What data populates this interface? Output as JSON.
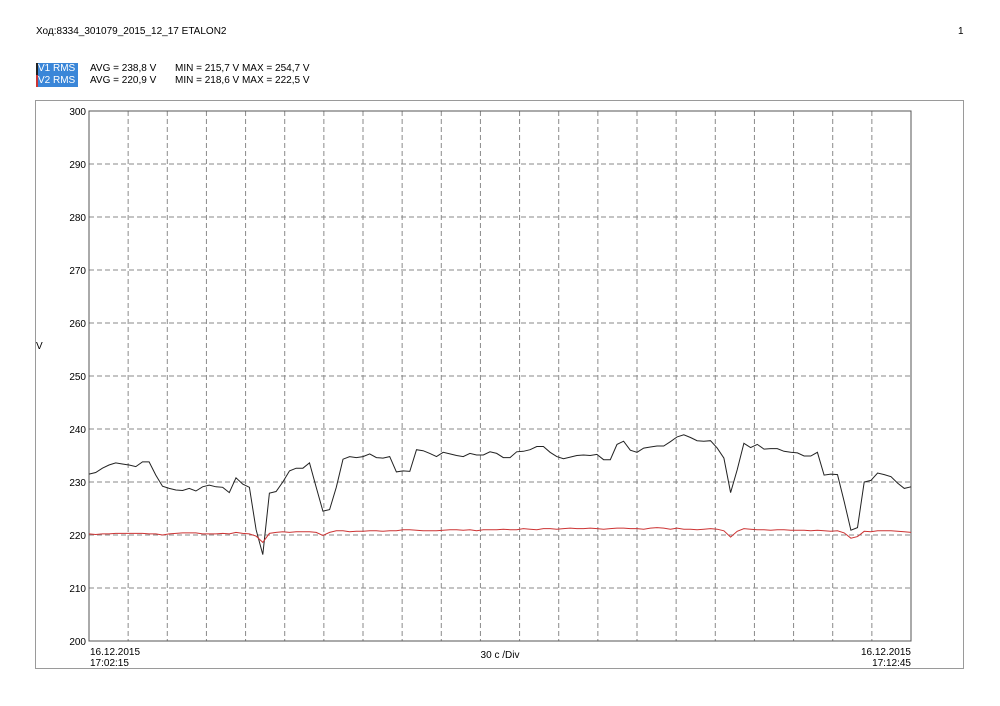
{
  "header": {
    "title": "Ход:8334_301079_2015_12_17 ETALON2",
    "page": "1"
  },
  "legend": [
    {
      "name": "V1 RMS",
      "avg": "AVG = 238,8 V",
      "minmax": "MIN = 215,7 V MAX = 254,7 V",
      "color": "#222222"
    },
    {
      "name": "V2 RMS",
      "avg": "AVG = 220,9 V",
      "minmax": "MIN = 218,6 V MAX = 222,5 V",
      "color": "#cc3333"
    }
  ],
  "axis": {
    "ylabel": "V",
    "xcenter": "30 c /Div",
    "start_date": "16.12.2015",
    "start_time": "17:02:15",
    "end_date": "16.12.2015",
    "end_time": "17:12:45"
  },
  "chart_data": {
    "type": "line",
    "ylabel": "V",
    "ylim": [
      200,
      300
    ],
    "yticks": [
      200,
      210,
      220,
      230,
      240,
      250,
      260,
      270,
      280,
      290,
      300
    ],
    "x_start": "16.12.2015 17:02:15",
    "x_end": "16.12.2015 17:12:45",
    "x_division": "30 c /Div",
    "grid": true,
    "series": [
      {
        "name": "V1 RMS",
        "color": "#222222",
        "values": [
          231.5,
          231.8,
          232.6,
          233.2,
          233.6,
          233.4,
          233.2,
          232.9,
          233.8,
          233.8,
          231.3,
          229.2,
          228.8,
          228.5,
          228.4,
          228.8,
          228.3,
          229.1,
          229.4,
          229.1,
          229.0,
          228.0,
          230.8,
          229.6,
          229.0,
          221.0,
          216.3,
          227.9,
          228.2,
          230.0,
          232.1,
          232.6,
          232.6,
          233.6,
          229.0,
          224.5,
          224.8,
          229.0,
          234.3,
          234.8,
          234.6,
          234.8,
          235.3,
          234.6,
          234.5,
          234.8,
          231.9,
          232.1,
          232.0,
          236.1,
          235.9,
          235.4,
          234.8,
          235.6,
          235.3,
          235.0,
          234.8,
          235.4,
          235.1,
          235.1,
          235.7,
          235.4,
          234.6,
          234.6,
          235.7,
          235.8,
          236.1,
          236.7,
          236.7,
          235.6,
          234.8,
          234.4,
          234.7,
          235.0,
          235.1,
          235.0,
          235.2,
          234.2,
          234.2,
          237.1,
          237.7,
          236.0,
          235.6,
          236.4,
          236.6,
          236.8,
          236.8,
          237.6,
          238.5,
          238.9,
          238.4,
          237.8,
          237.7,
          237.8,
          236.4,
          234.5,
          228.0,
          232.3,
          237.3,
          236.5,
          237.1,
          236.2,
          236.3,
          236.3,
          235.8,
          235.6,
          235.5,
          234.9,
          234.9,
          235.6,
          231.3,
          231.5,
          231.4,
          226.3,
          220.9,
          221.4,
          230.0,
          230.3,
          231.7,
          231.4,
          231.0,
          229.8,
          228.8,
          229.1
        ]
      },
      {
        "name": "V2 RMS",
        "color": "#cc3333",
        "values": [
          220.2,
          220.1,
          220.2,
          220.2,
          220.3,
          220.3,
          220.3,
          220.3,
          220.3,
          220.2,
          220.2,
          220.0,
          220.2,
          220.3,
          220.4,
          220.4,
          220.4,
          220.2,
          220.2,
          220.2,
          220.3,
          220.2,
          220.5,
          220.3,
          220.2,
          219.8,
          218.6,
          220.3,
          220.5,
          220.6,
          220.5,
          220.6,
          220.6,
          220.6,
          220.5,
          219.9,
          220.5,
          220.8,
          220.8,
          220.6,
          220.7,
          220.7,
          220.8,
          220.8,
          220.7,
          220.8,
          220.8,
          221.0,
          221.0,
          220.9,
          220.8,
          220.8,
          220.8,
          220.9,
          221.0,
          221.0,
          220.9,
          221.0,
          220.8,
          221.0,
          221.0,
          221.0,
          221.1,
          221.0,
          221.0,
          221.2,
          221.1,
          221.0,
          221.2,
          221.2,
          221.1,
          221.2,
          221.3,
          221.2,
          221.2,
          221.3,
          221.2,
          221.1,
          221.2,
          221.3,
          221.3,
          221.2,
          221.2,
          221.1,
          221.3,
          221.4,
          221.3,
          221.1,
          221.3,
          221.1,
          221.1,
          221.0,
          221.1,
          221.2,
          221.1,
          220.8,
          219.6,
          220.7,
          221.2,
          221.1,
          221.0,
          221.0,
          220.9,
          221.0,
          221.0,
          220.9,
          220.9,
          220.9,
          220.8,
          220.9,
          220.8,
          220.7,
          220.8,
          220.4,
          219.4,
          219.7,
          220.7,
          220.6,
          220.8,
          220.8,
          220.8,
          220.7,
          220.6,
          220.5
        ]
      }
    ]
  }
}
